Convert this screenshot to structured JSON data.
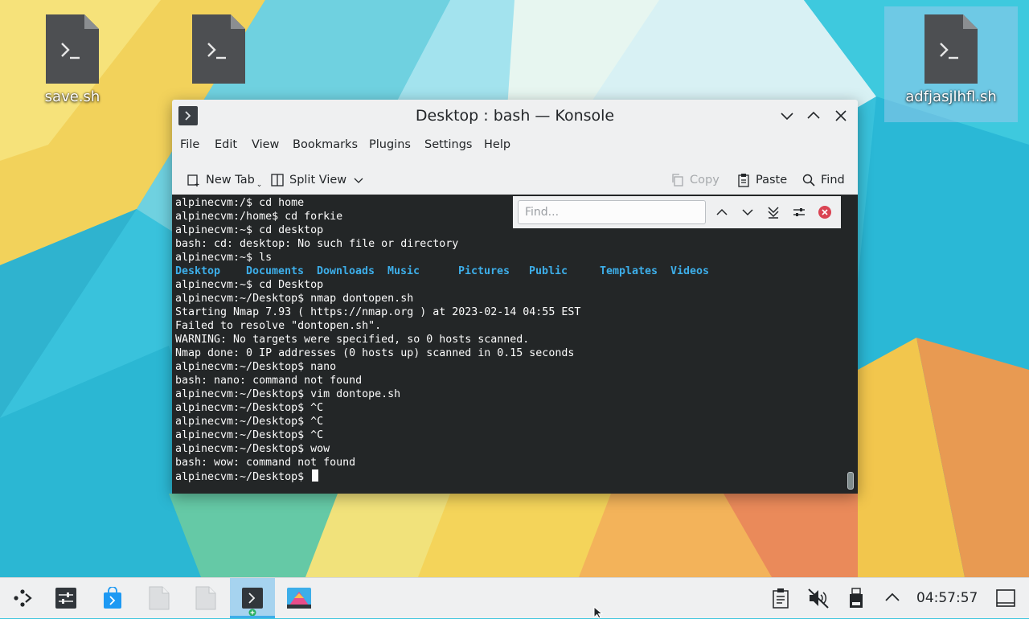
{
  "desktop": {
    "icons": [
      {
        "label": "save.sh"
      },
      {
        "label": ""
      },
      {
        "label": "adfjasjlhfl.sh"
      }
    ]
  },
  "window": {
    "title": "Desktop : bash — Konsole",
    "menus": [
      "File",
      "Edit",
      "View",
      "Bookmarks",
      "Plugins",
      "Settings",
      "Help"
    ],
    "toolbar": {
      "new_tab": "New Tab",
      "split_view": "Split View",
      "copy": "Copy",
      "paste": "Paste",
      "find": "Find"
    },
    "find_bar": {
      "placeholder": "Find..."
    }
  },
  "terminal": {
    "lines_before": [
      "alpinecvm:/$ cd home",
      "alpinecvm:/home$ cd forkie",
      "alpinecvm:~$ cd desktop",
      "bash: cd: desktop: No such file or directory",
      "alpinecvm:~$ ls"
    ],
    "ls_items": [
      "Desktop",
      "Documents",
      "Downloads",
      "Music",
      "Pictures",
      "Public",
      "Templates",
      "Videos"
    ],
    "lines_after": [
      "alpinecvm:~$ cd Desktop",
      "alpinecvm:~/Desktop$ nmap dontopen.sh",
      "Starting Nmap 7.93 ( https://nmap.org ) at 2023-02-14 04:55 EST",
      "Failed to resolve \"dontopen.sh\".",
      "WARNING: No targets were specified, so 0 hosts scanned.",
      "Nmap done: 0 IP addresses (0 hosts up) scanned in 0.15 seconds",
      "alpinecvm:~/Desktop$ nano",
      "bash: nano: command not found",
      "alpinecvm:~/Desktop$ vim dontope.sh",
      "alpinecvm:~/Desktop$ ^C",
      "alpinecvm:~/Desktop$ ^C",
      "alpinecvm:~/Desktop$ ^C",
      "alpinecvm:~/Desktop$ wow",
      "bash: wow: command not found"
    ],
    "prompt": "alpinecvm:~/Desktop$ "
  },
  "taskbar": {
    "clock": "04:57:57"
  },
  "colors": {
    "ls_dir": "#3daee9",
    "terminal_bg": "#232627",
    "close_red": "#da4453",
    "accent": "#3daee9"
  }
}
